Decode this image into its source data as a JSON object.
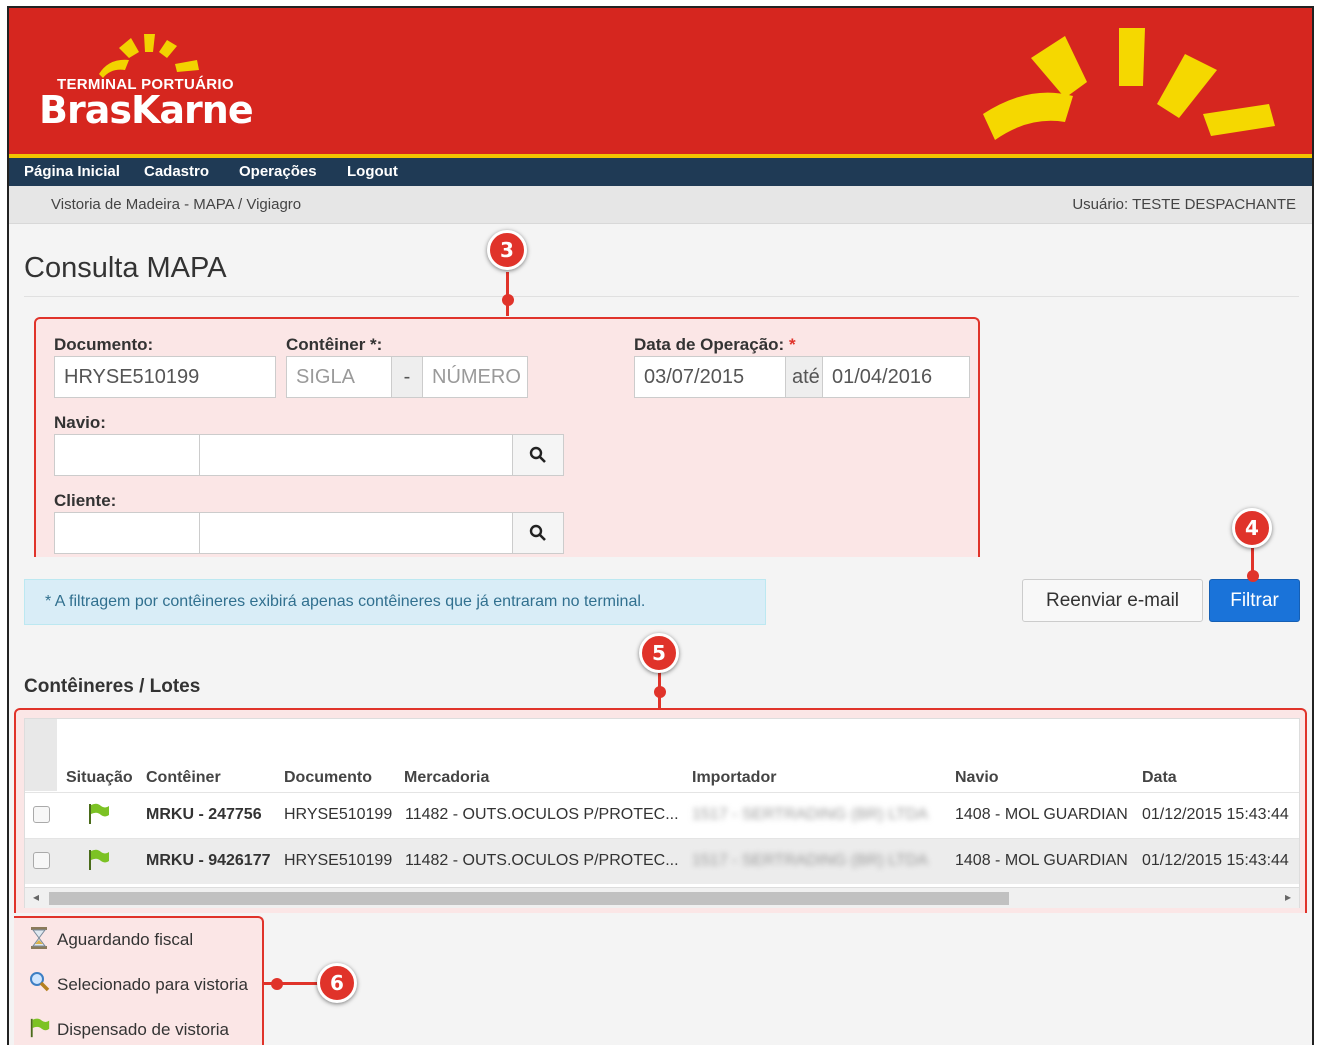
{
  "brand": {
    "tagline": "TERMINAL PORTUÁRIO",
    "name": "BrasKarne"
  },
  "nav": [
    "Página Inicial",
    "Cadastro",
    "Operações",
    "Logout"
  ],
  "breadcrumb": "Vistoria de Madeira - MAPA / Vigiagro",
  "user": "Usuário: TESTE DESPACHANTE",
  "page_title": "Consulta MAPA",
  "form": {
    "documento_label": "Documento:",
    "documento_value": "HRYSE510199",
    "container_label": "Contêiner *:",
    "sigla_placeholder": "SIGLA",
    "container_sep": "-",
    "numero_placeholder": "NÚMERO",
    "data_label": "Data de Operação:",
    "data_req": "*",
    "data_from": "03/07/2015",
    "data_sep": "até",
    "data_to": "01/04/2016",
    "navio_label": "Navio:",
    "cliente_label": "Cliente:"
  },
  "info": "* A filtragem por contêineres exibirá apenas contêineres que já entraram no terminal.",
  "buttons": {
    "resend": "Reenviar e-mail",
    "filter": "Filtrar"
  },
  "callouts": [
    "3",
    "4",
    "5",
    "6"
  ],
  "section_title": "Contêineres / Lotes",
  "table": {
    "headers": [
      "Situação",
      "Contêiner",
      "Documento",
      "Mercadoria",
      "Importador",
      "Navio",
      "Data"
    ],
    "rows": [
      {
        "container": "MRKU - 247756",
        "documento": "HRYSE510199",
        "mercadoria": "11482 - OUTS.OCULOS P/PROTEC...",
        "importador": "1517 - SERTRADING (BR) LTDA",
        "navio": "1408 - MOL GUARDIAN",
        "data": "01/12/2015 15:43:44"
      },
      {
        "container": "MRKU - 9426177",
        "documento": "HRYSE510199",
        "mercadoria": "11482 - OUTS.OCULOS P/PROTEC...",
        "importador": "1517 - SERTRADING (BR) LTDA",
        "navio": "1408 - MOL GUARDIAN",
        "data": "01/12/2015 15:43:44"
      }
    ]
  },
  "legend": [
    {
      "icon": "hourglass-icon",
      "label": "Aguardando fiscal"
    },
    {
      "icon": "magnifier-icon",
      "label": "Selecionado para vistoria"
    },
    {
      "icon": "green-flag-icon",
      "label": "Dispensado de vistoria"
    }
  ],
  "colors": {
    "header_red": "#d6261f",
    "nav_blue": "#1f3a55",
    "accent_yellow": "#f2c400",
    "primary_button": "#1a73d9",
    "callout_red": "#e0332a"
  }
}
